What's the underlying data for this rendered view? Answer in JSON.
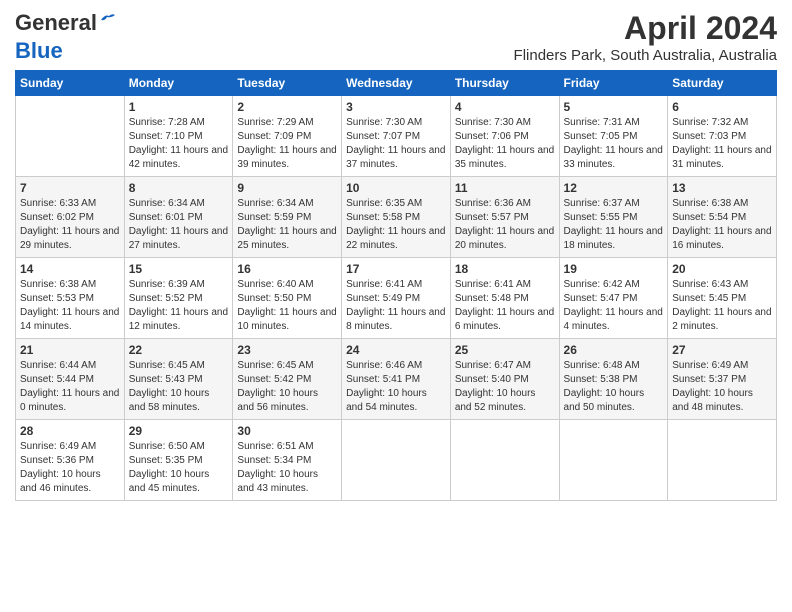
{
  "logo": {
    "general": "General",
    "blue": "Blue"
  },
  "title": "April 2024",
  "subtitle": "Flinders Park, South Australia, Australia",
  "headers": [
    "Sunday",
    "Monday",
    "Tuesday",
    "Wednesday",
    "Thursday",
    "Friday",
    "Saturday"
  ],
  "weeks": [
    [
      {
        "day": "",
        "sunrise": "",
        "sunset": "",
        "daylight": ""
      },
      {
        "day": "1",
        "sunrise": "Sunrise: 7:28 AM",
        "sunset": "Sunset: 7:10 PM",
        "daylight": "Daylight: 11 hours and 42 minutes."
      },
      {
        "day": "2",
        "sunrise": "Sunrise: 7:29 AM",
        "sunset": "Sunset: 7:09 PM",
        "daylight": "Daylight: 11 hours and 39 minutes."
      },
      {
        "day": "3",
        "sunrise": "Sunrise: 7:30 AM",
        "sunset": "Sunset: 7:07 PM",
        "daylight": "Daylight: 11 hours and 37 minutes."
      },
      {
        "day": "4",
        "sunrise": "Sunrise: 7:30 AM",
        "sunset": "Sunset: 7:06 PM",
        "daylight": "Daylight: 11 hours and 35 minutes."
      },
      {
        "day": "5",
        "sunrise": "Sunrise: 7:31 AM",
        "sunset": "Sunset: 7:05 PM",
        "daylight": "Daylight: 11 hours and 33 minutes."
      },
      {
        "day": "6",
        "sunrise": "Sunrise: 7:32 AM",
        "sunset": "Sunset: 7:03 PM",
        "daylight": "Daylight: 11 hours and 31 minutes."
      }
    ],
    [
      {
        "day": "7",
        "sunrise": "Sunrise: 6:33 AM",
        "sunset": "Sunset: 6:02 PM",
        "daylight": "Daylight: 11 hours and 29 minutes."
      },
      {
        "day": "8",
        "sunrise": "Sunrise: 6:34 AM",
        "sunset": "Sunset: 6:01 PM",
        "daylight": "Daylight: 11 hours and 27 minutes."
      },
      {
        "day": "9",
        "sunrise": "Sunrise: 6:34 AM",
        "sunset": "Sunset: 5:59 PM",
        "daylight": "Daylight: 11 hours and 25 minutes."
      },
      {
        "day": "10",
        "sunrise": "Sunrise: 6:35 AM",
        "sunset": "Sunset: 5:58 PM",
        "daylight": "Daylight: 11 hours and 22 minutes."
      },
      {
        "day": "11",
        "sunrise": "Sunrise: 6:36 AM",
        "sunset": "Sunset: 5:57 PM",
        "daylight": "Daylight: 11 hours and 20 minutes."
      },
      {
        "day": "12",
        "sunrise": "Sunrise: 6:37 AM",
        "sunset": "Sunset: 5:55 PM",
        "daylight": "Daylight: 11 hours and 18 minutes."
      },
      {
        "day": "13",
        "sunrise": "Sunrise: 6:38 AM",
        "sunset": "Sunset: 5:54 PM",
        "daylight": "Daylight: 11 hours and 16 minutes."
      }
    ],
    [
      {
        "day": "14",
        "sunrise": "Sunrise: 6:38 AM",
        "sunset": "Sunset: 5:53 PM",
        "daylight": "Daylight: 11 hours and 14 minutes."
      },
      {
        "day": "15",
        "sunrise": "Sunrise: 6:39 AM",
        "sunset": "Sunset: 5:52 PM",
        "daylight": "Daylight: 11 hours and 12 minutes."
      },
      {
        "day": "16",
        "sunrise": "Sunrise: 6:40 AM",
        "sunset": "Sunset: 5:50 PM",
        "daylight": "Daylight: 11 hours and 10 minutes."
      },
      {
        "day": "17",
        "sunrise": "Sunrise: 6:41 AM",
        "sunset": "Sunset: 5:49 PM",
        "daylight": "Daylight: 11 hours and 8 minutes."
      },
      {
        "day": "18",
        "sunrise": "Sunrise: 6:41 AM",
        "sunset": "Sunset: 5:48 PM",
        "daylight": "Daylight: 11 hours and 6 minutes."
      },
      {
        "day": "19",
        "sunrise": "Sunrise: 6:42 AM",
        "sunset": "Sunset: 5:47 PM",
        "daylight": "Daylight: 11 hours and 4 minutes."
      },
      {
        "day": "20",
        "sunrise": "Sunrise: 6:43 AM",
        "sunset": "Sunset: 5:45 PM",
        "daylight": "Daylight: 11 hours and 2 minutes."
      }
    ],
    [
      {
        "day": "21",
        "sunrise": "Sunrise: 6:44 AM",
        "sunset": "Sunset: 5:44 PM",
        "daylight": "Daylight: 11 hours and 0 minutes."
      },
      {
        "day": "22",
        "sunrise": "Sunrise: 6:45 AM",
        "sunset": "Sunset: 5:43 PM",
        "daylight": "Daylight: 10 hours and 58 minutes."
      },
      {
        "day": "23",
        "sunrise": "Sunrise: 6:45 AM",
        "sunset": "Sunset: 5:42 PM",
        "daylight": "Daylight: 10 hours and 56 minutes."
      },
      {
        "day": "24",
        "sunrise": "Sunrise: 6:46 AM",
        "sunset": "Sunset: 5:41 PM",
        "daylight": "Daylight: 10 hours and 54 minutes."
      },
      {
        "day": "25",
        "sunrise": "Sunrise: 6:47 AM",
        "sunset": "Sunset: 5:40 PM",
        "daylight": "Daylight: 10 hours and 52 minutes."
      },
      {
        "day": "26",
        "sunrise": "Sunrise: 6:48 AM",
        "sunset": "Sunset: 5:38 PM",
        "daylight": "Daylight: 10 hours and 50 minutes."
      },
      {
        "day": "27",
        "sunrise": "Sunrise: 6:49 AM",
        "sunset": "Sunset: 5:37 PM",
        "daylight": "Daylight: 10 hours and 48 minutes."
      }
    ],
    [
      {
        "day": "28",
        "sunrise": "Sunrise: 6:49 AM",
        "sunset": "Sunset: 5:36 PM",
        "daylight": "Daylight: 10 hours and 46 minutes."
      },
      {
        "day": "29",
        "sunrise": "Sunrise: 6:50 AM",
        "sunset": "Sunset: 5:35 PM",
        "daylight": "Daylight: 10 hours and 45 minutes."
      },
      {
        "day": "30",
        "sunrise": "Sunrise: 6:51 AM",
        "sunset": "Sunset: 5:34 PM",
        "daylight": "Daylight: 10 hours and 43 minutes."
      },
      {
        "day": "",
        "sunrise": "",
        "sunset": "",
        "daylight": ""
      },
      {
        "day": "",
        "sunrise": "",
        "sunset": "",
        "daylight": ""
      },
      {
        "day": "",
        "sunrise": "",
        "sunset": "",
        "daylight": ""
      },
      {
        "day": "",
        "sunrise": "",
        "sunset": "",
        "daylight": ""
      }
    ]
  ]
}
